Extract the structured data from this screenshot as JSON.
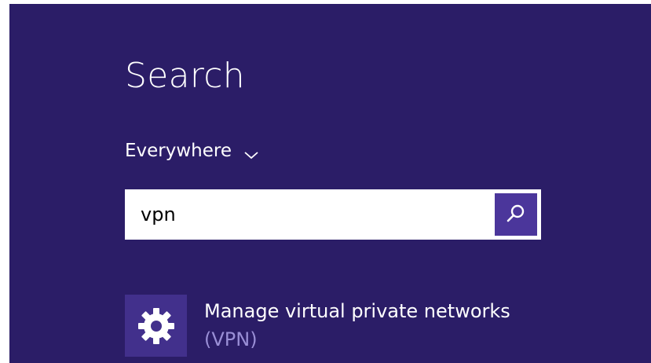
{
  "search": {
    "title": "Search",
    "scope_label": "Everywhere",
    "query": "vpn"
  },
  "icons": {
    "scope": "chevron-down-icon",
    "search_button": "search-icon",
    "result": "gear-icon"
  },
  "results": [
    {
      "label_prefix": "Manage virtual private networks",
      "label_highlight": "(VPN)"
    }
  ],
  "colors": {
    "background": "#2b1d67",
    "accent": "#4b369b",
    "tile": "#42308c",
    "highlight_text": "#9a8fd6"
  }
}
